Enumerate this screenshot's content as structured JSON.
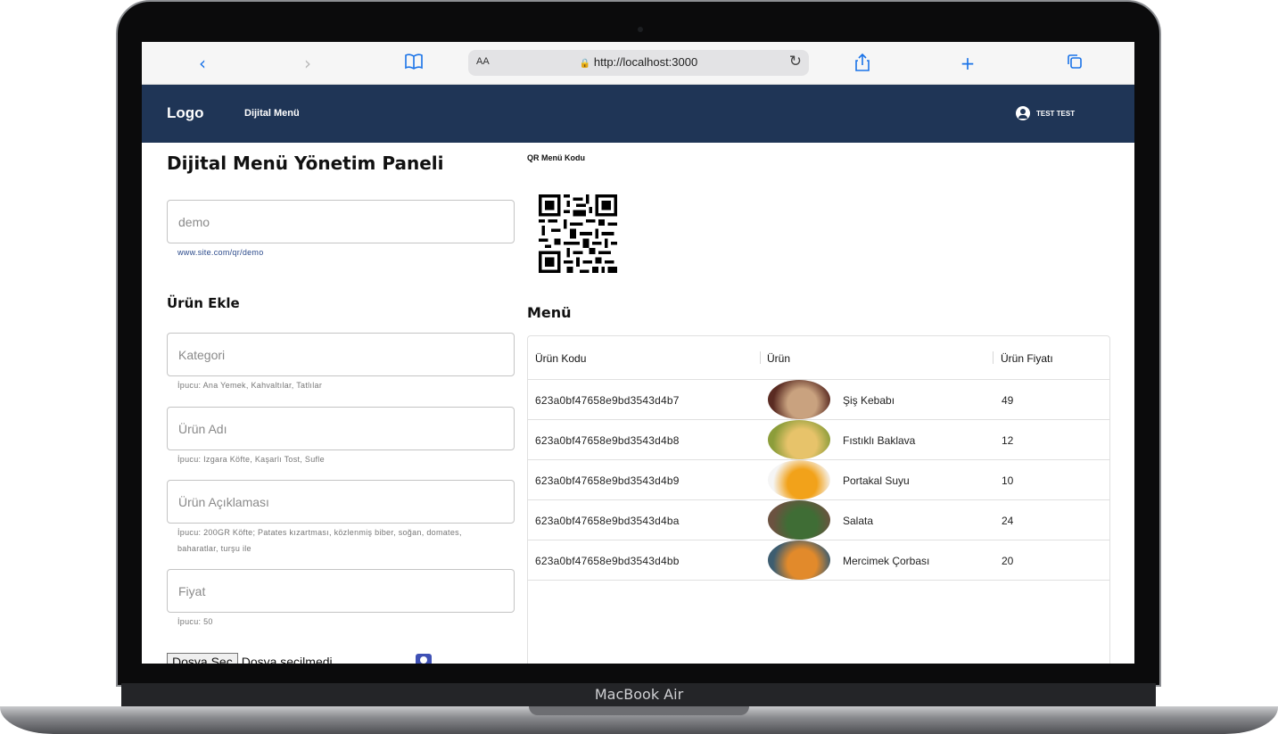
{
  "device": {
    "brand": "MacBook Air"
  },
  "browser": {
    "url": "http://localhost:3000",
    "text_size_label": "AA"
  },
  "navbar": {
    "logo": "Logo",
    "link": "Dijital Menü",
    "user": "TEST TEST"
  },
  "panel": {
    "title": "Dijital Menü Yönetim Paneli",
    "slug_placeholder": "demo",
    "slug_link": "www.site.com/qr/demo",
    "add_product_title": "Ürün Ekle",
    "fields": [
      {
        "placeholder": "Kategori",
        "hint": "İpucu: Ana Yemek, Kahvaltılar, Tatlılar"
      },
      {
        "placeholder": "Ürün Adı",
        "hint": "İpucu: Izgara Köfte, Kaşarlı Tost, Sufle"
      },
      {
        "placeholder": "Ürün Açıklaması",
        "hint": "İpucu: 200GR Köfte; Patates kızartması, közlenmiş biber, soğan, domates, baharatlar, turşu ile"
      },
      {
        "placeholder": "Fiyat",
        "hint": "İpucu: 50"
      }
    ],
    "file_button": "Dosya Seç",
    "file_status": "Dosya seçilmedi"
  },
  "qr": {
    "label": "QR Menü Kodu"
  },
  "menu": {
    "title": "Menü",
    "columns": [
      "Ürün Kodu",
      "Ürün",
      "Ürün Fiyatı"
    ],
    "rows": [
      {
        "code": "623a0bf47658e9bd3543d4b7",
        "name": "Şiş Kebabı",
        "price": "49",
        "image_colors": [
          "#5a2b22",
          "#c9a27f"
        ]
      },
      {
        "code": "623a0bf47658e9bd3543d4b8",
        "name": "Fıstıklı Baklava",
        "price": "12",
        "image_colors": [
          "#8c9d3a",
          "#e7c36a"
        ]
      },
      {
        "code": "623a0bf47658e9bd3543d4b9",
        "name": "Portakal Suyu",
        "price": "10",
        "image_colors": [
          "#f5f5f5",
          "#f2a21a"
        ]
      },
      {
        "code": "623a0bf47658e9bd3543d4ba",
        "name": "Salata",
        "price": "24",
        "image_colors": [
          "#6b5240",
          "#3f6d35"
        ]
      },
      {
        "code": "623a0bf47658e9bd3543d4bb",
        "name": "Mercimek Çorbası",
        "price": "20",
        "image_colors": [
          "#3d5d70",
          "#e28a2b"
        ]
      }
    ]
  }
}
